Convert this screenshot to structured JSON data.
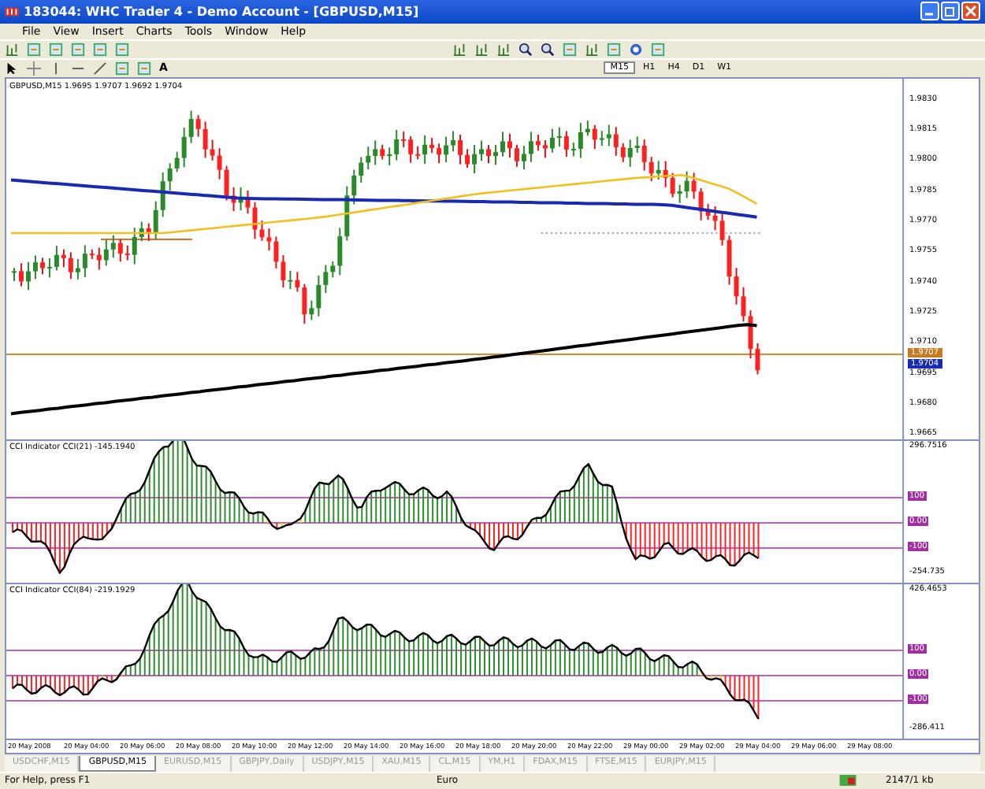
{
  "window": {
    "title": "183044: WHC Trader 4 - Demo Account - [GBPUSD,M15]"
  },
  "menu": [
    "File",
    "View",
    "Insert",
    "Charts",
    "Tools",
    "Window",
    "Help"
  ],
  "text_tool": "A",
  "timeframes": [
    {
      "label": "M15",
      "selected": true
    },
    {
      "label": "H1",
      "selected": false
    },
    {
      "label": "H4",
      "selected": false
    },
    {
      "label": "D1",
      "selected": false
    },
    {
      "label": "W1",
      "selected": false
    }
  ],
  "chart": {
    "header": "GBPUSD,M15  1.9695 1.9707 1.9692 1.9704",
    "price_ticks": [
      "1.9830",
      "1.9815",
      "1.9800",
      "1.9785",
      "1.9770",
      "1.9755",
      "1.9740",
      "1.9725",
      "1.9710",
      "1.9695",
      "1.9680",
      "1.9665"
    ],
    "ask_label": "1.9707",
    "bid_label": "1.9704"
  },
  "indicators": [
    {
      "header": "CCI Indicator  CCI(21) -145.1940",
      "max": "296.7516",
      "levels": [
        "100",
        "0.00",
        "-100"
      ],
      "min": "-254.735"
    },
    {
      "header": "CCI Indicator  CCI(84) -219.1929",
      "max": "426.4653",
      "levels": [
        "100",
        "0.00",
        "-100"
      ],
      "min": "-286.411"
    }
  ],
  "time_labels": [
    "20 May 2008",
    "20 May 04:00",
    "20 May 06:00",
    "20 May 08:00",
    "20 May 10:00",
    "20 May 12:00",
    "20 May 14:00",
    "20 May 16:00",
    "20 May 18:00",
    "20 May 20:00",
    "20 May 22:00",
    "29 May 00:00",
    "29 May 02:00",
    "29 May 04:00",
    "29 May 06:00",
    "29 May 08:00"
  ],
  "tabs": [
    {
      "label": "USDCHF,M15",
      "selected": false
    },
    {
      "label": "GBPUSD,M15",
      "selected": true
    },
    {
      "label": "EURUSD,M15",
      "selected": false
    },
    {
      "label": "GBPJPY,Daily",
      "selected": false
    },
    {
      "label": "USDJPY,M15",
      "selected": false
    },
    {
      "label": "XAU,M15",
      "selected": false
    },
    {
      "label": "CL,M15",
      "selected": false
    },
    {
      "label": "YM,H1",
      "selected": false
    },
    {
      "label": "FDAX,M15",
      "selected": false
    },
    {
      "label": "FTSE,M15",
      "selected": false
    },
    {
      "label": "EURJPY,M15",
      "selected": false
    }
  ],
  "status_bar": {
    "help": "For Help, press F1",
    "profile": "Euro",
    "traffic": "2147/1 kb"
  }
}
